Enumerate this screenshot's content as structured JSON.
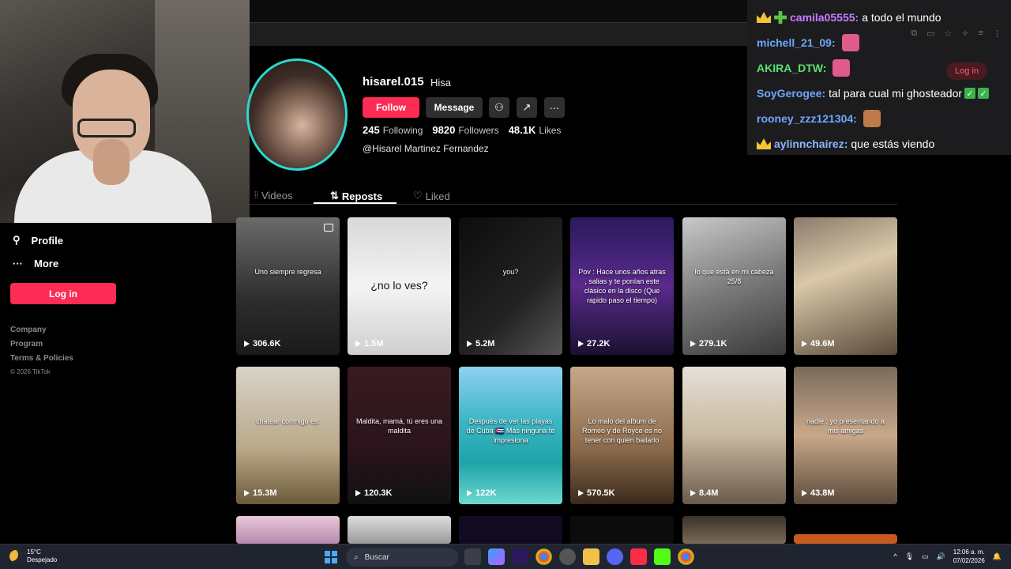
{
  "chat": {
    "messages": [
      {
        "user": "camila05555:",
        "user_color": "#c77dff",
        "text": "a todo el mundo",
        "badges": [
          "crown",
          "plus"
        ]
      },
      {
        "user": "michell_21_09:",
        "user_color": "#6fa8ff",
        "text": "",
        "emote": "#e05a8a"
      },
      {
        "user": "AKIRA_DTW:",
        "user_color": "#5be06f",
        "text": "",
        "emote": "#e05a8a"
      },
      {
        "user": "SoyGerogee:",
        "user_color": "#6fa8ff",
        "text": "tal para cual mi ghosteador",
        "checks": 2
      },
      {
        "user": "rooney_zzz121304:",
        "user_color": "#6fa8ff",
        "text": "",
        "emote": "#c07a4a"
      },
      {
        "user": "aylinnchairez:",
        "user_color": "#8bb7ff",
        "text": "que estás viendo",
        "badges": [
          "crown"
        ]
      }
    ],
    "login_label": "Log in"
  },
  "profile": {
    "username": "hisarel.015",
    "nickname": "Hisa",
    "follow_label": "Follow",
    "message_label": "Message",
    "following_count": "245",
    "following_label": "Following",
    "followers_count": "9820",
    "followers_label": "Followers",
    "likes_count": "48.1K",
    "likes_label": "Likes",
    "bio": "@Hisarel Martinez Fernandez"
  },
  "tabs": {
    "videos": "Videos",
    "reposts": "Reposts",
    "liked": "Liked"
  },
  "sidebar": {
    "profile": "Profile",
    "more": "More",
    "login": "Log in",
    "footer": [
      "Company",
      "Program",
      "Terms & Policies"
    ],
    "copyright": "© 2026 TikTok"
  },
  "videos": [
    {
      "views": "306.6K",
      "caption": "Uno siempre regresa",
      "bg": "linear-gradient(180deg,#6b6b6b,#2d2d2d 60%,#1a1a1a)",
      "multi": true
    },
    {
      "views": "1.5M",
      "caption": "¿no lo ves?",
      "bg": "linear-gradient(180deg,#d8d8d8,#f4f4f4 50%,#cfcfcf)",
      "dark_text": true
    },
    {
      "views": "5.2M",
      "caption": "you?",
      "bg": "linear-gradient(135deg,#0d0d0d,#222 60%,#555)"
    },
    {
      "views": "27.2K",
      "caption": "Pov : Hace unos años atras , salias y te ponían este clásico en la disco (Que rapido paso el tiempo)",
      "bg": "linear-gradient(180deg,#2a1a5c,#5a2a8c 50%,#1a1030)"
    },
    {
      "views": "279.1K",
      "caption": "lo que está en mi cabeza 25/8",
      "bg": "linear-gradient(160deg,#c9c9c9,#7a7a7a 50%,#3a3a3a)"
    },
    {
      "views": "49.6M",
      "caption": "",
      "bg": "linear-gradient(160deg,#8a7a6a,#d9c8a8 40%,#5a4a3a)"
    },
    {
      "views": "15.3M",
      "caption": "chatear conmigo es:",
      "bg": "linear-gradient(180deg,#d8d2c8,#b9a989 60%,#6b5a3a)"
    },
    {
      "views": "120.3K",
      "caption": "Maldita, mamá, tú eres una maldita",
      "bg": "linear-gradient(180deg,#3a1a22,#2a141a 60%,#111)"
    },
    {
      "views": "122K",
      "caption": "Después de ver las playas de Cuba 🇨🇺 Más ninguna te impresiona",
      "bg": "linear-gradient(180deg,#8fd0f0 0%,#3bb7c4 40%,#1ea3a8 70%,#6fd8d0 100%)"
    },
    {
      "views": "570.5K",
      "caption": "Lo malo del album de Romeo y de Royce es no tener con quien bailarlo",
      "bg": "linear-gradient(180deg,#c7a88a,#8a6a4a 60%,#3a2a1a)"
    },
    {
      "views": "8.4M",
      "caption": "",
      "bg": "linear-gradient(180deg,#e5e0d8,#c9b9a0 50%,#6a5a4a)"
    },
    {
      "views": "43.8M",
      "caption": "nadie : yo presentando a mis amigas",
      "bg": "linear-gradient(180deg,#7a6a5a,#c9a88a 50%,#5a4a3a)"
    }
  ],
  "taskbar": {
    "temp": "15°C",
    "condition": "Despejado",
    "search": "Buscar",
    "time": "12:06 a. m.",
    "date": "07/02/2026"
  }
}
